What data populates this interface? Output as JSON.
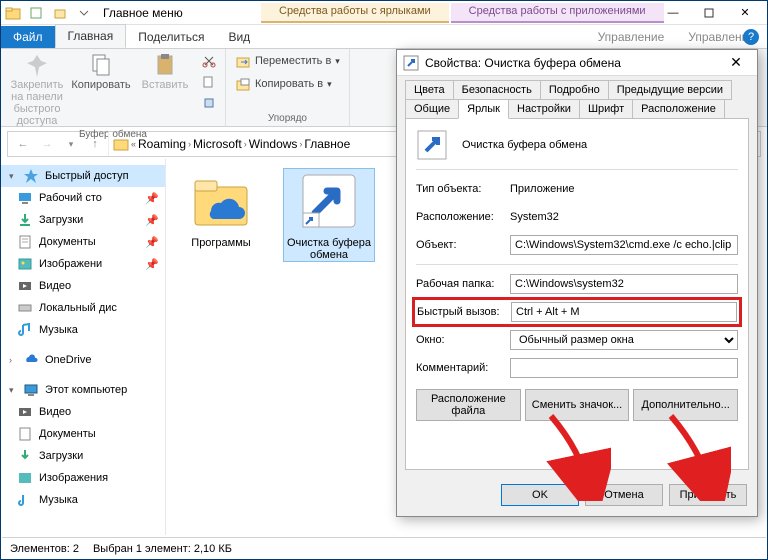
{
  "window": {
    "title": "Главное меню"
  },
  "context_tabs": {
    "shortcut": "Средства работы с ярлыками",
    "app": "Средства работы с приложениями",
    "manage": "Управление"
  },
  "ribbon_tabs": {
    "file": "Файл",
    "home": "Главная",
    "share": "Поделиться",
    "view": "Вид"
  },
  "ribbon": {
    "pin": "Закрепить на панели\nбыстрого доступа",
    "copy": "Копировать",
    "paste": "Вставить",
    "group_clip": "Буфер обмена",
    "move_to": "Переместить в",
    "copy_to": "Копировать в",
    "group_org": "Упорядо"
  },
  "breadcrumb": [
    "Roaming",
    "Microsoft",
    "Windows",
    "Главное"
  ],
  "nav": {
    "quick": "Быстрый доступ",
    "desktop": "Рабочий сто",
    "downloads": "Загрузки",
    "documents": "Документы",
    "pictures": "Изображени",
    "videos": "Видео",
    "localdisk": "Локальный дис",
    "music": "Музыка",
    "onedrive": "OneDrive",
    "thispc": "Этот компьютер",
    "pc_videos": "Видео",
    "pc_documents": "Документы",
    "pc_downloads": "Загрузки",
    "pc_pictures": "Изображения",
    "pc_music": "Музыка"
  },
  "files": {
    "programs": "Программы",
    "cleanup": "Очистка буфера обмена"
  },
  "status": {
    "count": "Элементов: 2",
    "sel": "Выбран 1 элемент: 2,10 КБ"
  },
  "dialog": {
    "title": "Свойства: Очистка буфера обмена",
    "tabs": {
      "colors": "Цвета",
      "security": "Безопасность",
      "details": "Подробно",
      "prev": "Предыдущие версии",
      "general": "Общие",
      "shortcut": "Ярлык",
      "settings": "Настройки",
      "font": "Шрифт",
      "layout": "Расположение"
    },
    "name": "Очистка буфера обмена",
    "type_lbl": "Тип объекта:",
    "type_val": "Приложение",
    "loc_lbl": "Расположение:",
    "loc_val": "System32",
    "target_lbl": "Объект:",
    "target_val": "C:\\Windows\\System32\\cmd.exe /c echo.|clip",
    "workdir_lbl": "Рабочая папка:",
    "workdir_val": "C:\\Windows\\system32",
    "hotkey_lbl": "Быстрый вызов:",
    "hotkey_val": "Ctrl + Alt + M",
    "window_lbl": "Окно:",
    "window_val": "Обычный размер окна",
    "comment_lbl": "Комментарий:",
    "comment_val": "",
    "btn_location": "Расположение файла",
    "btn_icon": "Сменить значок...",
    "btn_adv": "Дополнительно...",
    "ok": "OK",
    "cancel": "Отмена",
    "apply": "Применить"
  }
}
